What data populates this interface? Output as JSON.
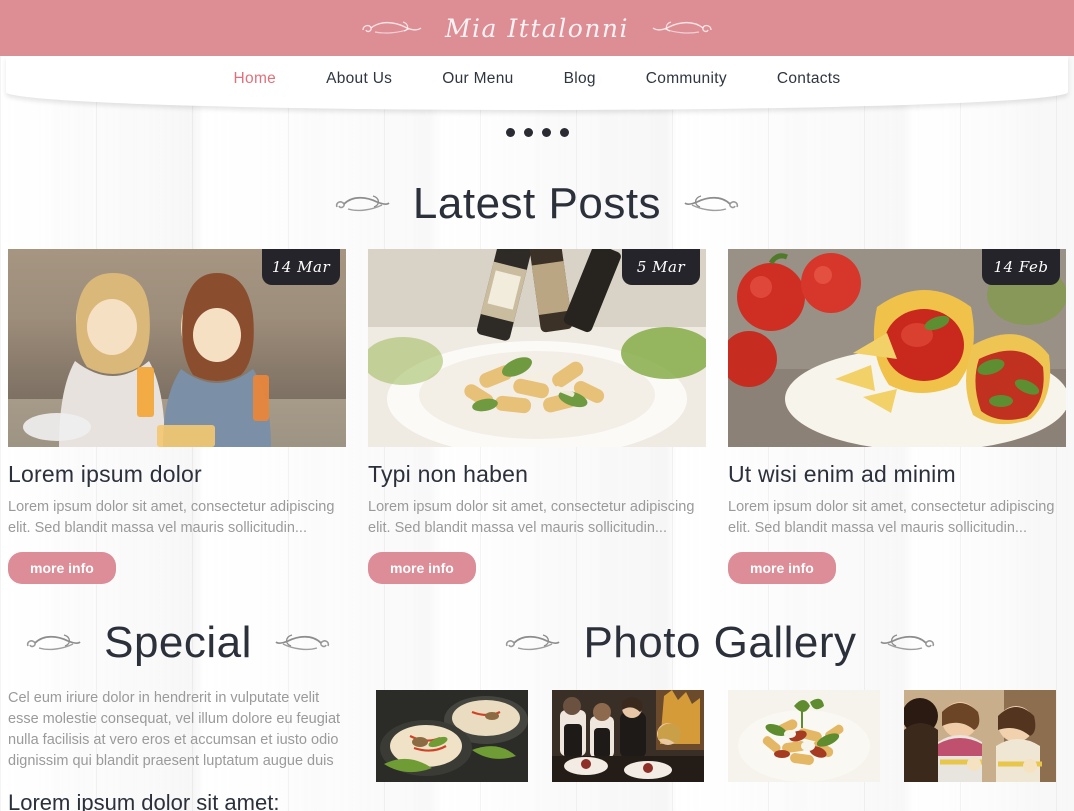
{
  "site": {
    "brand_name": "Mia Ittalonni",
    "header_bg": "#dd8d94",
    "accent_color": "#dc8d97",
    "heading_color": "#2b303b",
    "body_text_color": "#9a9a9a"
  },
  "nav": {
    "items": [
      {
        "label": "Home",
        "active": true
      },
      {
        "label": "About Us",
        "active": false
      },
      {
        "label": "Our Menu",
        "active": false
      },
      {
        "label": "Blog",
        "active": false
      },
      {
        "label": "Community",
        "active": false
      },
      {
        "label": "Contacts",
        "active": false
      }
    ]
  },
  "slider": {
    "dot_count": 4,
    "active_index": 0
  },
  "latest_posts": {
    "heading": "Latest Posts",
    "posts": [
      {
        "date": "14 Mar",
        "title": "Lorem ipsum dolor",
        "excerpt": "Lorem ipsum dolor sit amet, consectetur adipiscing elit. Sed blandit massa vel mauris sollicitudin...",
        "button_label": "more info",
        "image_name": "two-women-dining-photo"
      },
      {
        "date": "5 Mar",
        "title": "Typi non haben",
        "excerpt": "Lorem ipsum dolor sit amet, consectetur adipiscing elit. Sed blandit massa vel mauris sollicitudin...",
        "button_label": "more info",
        "image_name": "pasta-with-wine-bottles-photo"
      },
      {
        "date": "14 Feb",
        "title": "Ut wisi enim ad minim",
        "excerpt": "Lorem ipsum dolor sit amet, consectetur adipiscing elit. Sed blandit massa vel mauris sollicitudin...",
        "button_label": "more info",
        "image_name": "tacos-with-salsa-photo"
      }
    ]
  },
  "special": {
    "heading": "Special",
    "body": "Cel eum iriure dolor in hendrerit in vulputate velit esse molestie consequat, vel illum dolore eu feugiat nulla facilisis at vero eros et accumsan et iusto odio dignissim qui blandit praesent luptatum augue duis",
    "subtitle": "Lorem ipsum dolor sit amet:"
  },
  "photo_gallery": {
    "heading": "Photo Gallery",
    "items": [
      {
        "image_name": "noodle-bowls-photo"
      },
      {
        "image_name": "restaurant-diners-photo"
      },
      {
        "image_name": "penne-pasta-photo"
      },
      {
        "image_name": "family-eating-photo"
      }
    ]
  }
}
